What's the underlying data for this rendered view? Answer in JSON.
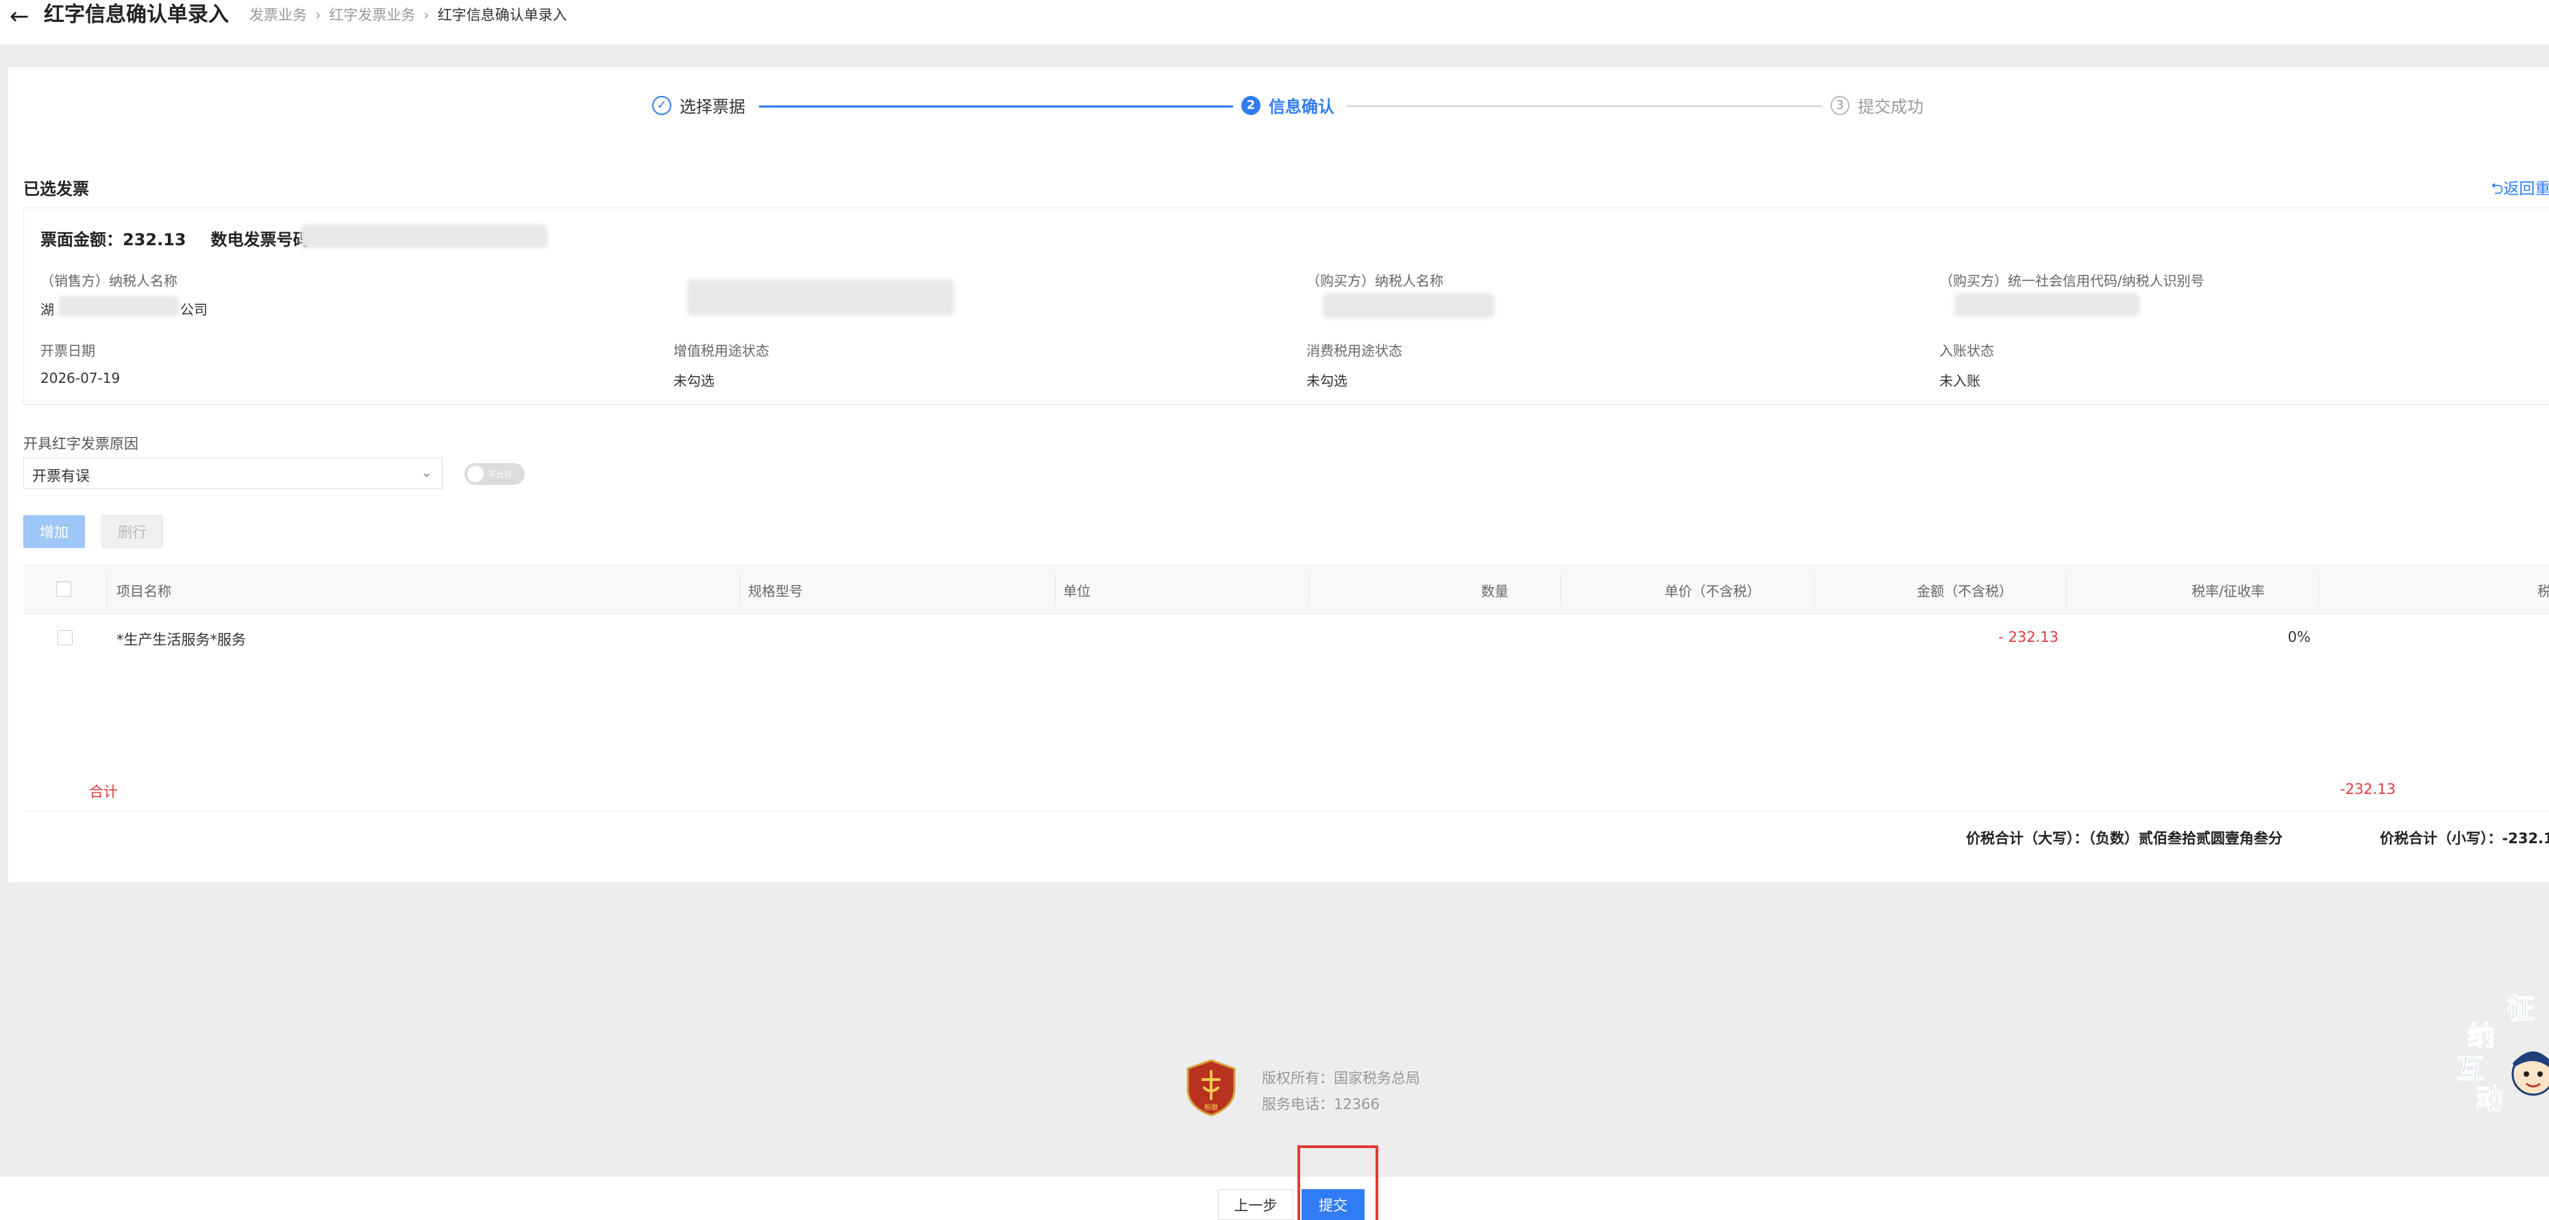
{
  "header": {
    "title": "红字信息确认单录入",
    "breadcrumbs": [
      "发票业务",
      "红字发票业务",
      "红字信息确认单录入"
    ]
  },
  "steps": [
    {
      "num": "✓",
      "label": "选择票据"
    },
    {
      "num": "2",
      "label": "信息确认"
    },
    {
      "num": "3",
      "label": "提交成功"
    }
  ],
  "section": {
    "title": "已选发票",
    "return_link": "⮌返回重"
  },
  "invoice": {
    "amount_label": "票面金额：232.13",
    "number_label": "数电发票号码",
    "seller_name_label": "（销售方）纳税人名称",
    "seller_name_prefix": "湖",
    "seller_name_suffix": "公司",
    "buyer_name_label": "（购买方）纳税人名称",
    "buyer_id_label": "（购买方）统一社会信用代码/纳税人识别号",
    "date_label": "开票日期",
    "date_value": "2026-07-19",
    "vat_status_label": "增值税用途状态",
    "vat_status_value": "未勾选",
    "consume_status_label": "消费税用途状态",
    "consume_status_value": "未勾选",
    "entry_status_label": "入账状态",
    "entry_status_value": "未入账"
  },
  "reason": {
    "label": "开具红字发票原因",
    "value": "开票有误",
    "toggle_text": "不允许"
  },
  "buttons": {
    "add": "增加",
    "delete": "删行",
    "prev": "上一步",
    "submit": "提交"
  },
  "table": {
    "headers": [
      "项目名称",
      "规格型号",
      "单位",
      "数量",
      "单价（不含税）",
      "金额（不含税）",
      "税率/征收率",
      "税"
    ],
    "rows": [
      {
        "name": "*生产生活服务*服务",
        "spec": "",
        "unit": "",
        "qty": "",
        "price": "",
        "amount": "- 232.13",
        "rate": "0%"
      }
    ],
    "total_label": "合计",
    "total_amount": "-232.13",
    "price_total_upper": "价税合计（大写）：（负数）贰佰叁拾贰圆壹角叁分",
    "price_total_lower": "价税合计（小写）：-232.1"
  },
  "footer": {
    "emblem_text": "税徽",
    "copyright": "版权所有：国家税务总局",
    "phone": "服务电话：12366"
  },
  "mascot": {
    "chars": [
      "征",
      "纳",
      "互",
      "动"
    ]
  },
  "colors": {
    "primary": "#2f7cf4",
    "negative": "#e03b3b",
    "highlight": "#e53935"
  }
}
